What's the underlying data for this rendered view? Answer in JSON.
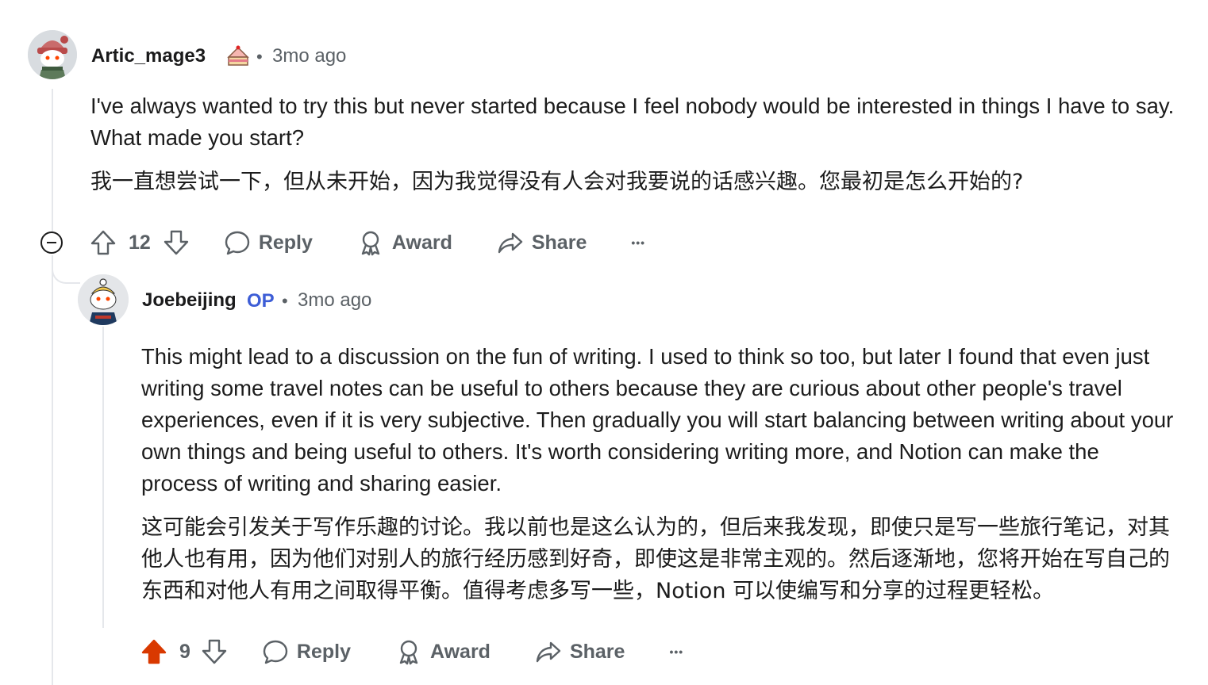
{
  "comment": {
    "username": "Artic_mage3",
    "separator": "•",
    "time": "3mo ago",
    "body_en": "I've always wanted to try this but never started because I feel nobody would be interested in things I have to say. What made you start?",
    "body_zh": "我一直想尝试一下，但从未开始，因为我觉得没有人会对我要说的话感兴趣。您最初是怎么开始的?",
    "votes": "12",
    "reply_label": "Reply",
    "award_label": "Award",
    "share_label": "Share",
    "more_label": "•••"
  },
  "reply": {
    "username": "Joebeijing",
    "op_badge": "OP",
    "separator": "•",
    "time": "3mo ago",
    "body_en": "This might lead to a discussion on the fun of writing. I used to think so too, but later I found that even just writing some travel notes can be useful to others because they are curious about other people's travel experiences, even if it is very subjective. Then gradually you will start balancing between writing about your own things and being useful to others. It's worth considering writing more, and Notion can make the process of writing and sharing easier.",
    "body_zh": "这可能会引发关于写作乐趣的讨论。我以前也是这么认为的，但后来我发现，即使只是写一些旅行笔记，对其他人也有用，因为他们对别人的旅行经历感到好奇，即使这是非常主观的。然后逐渐地，您将开始在写自己的东西和对他人有用之间取得平衡。值得考虑多写一些，Notion 可以使编写和分享的过程更轻松。",
    "votes": "9",
    "upvoted": true,
    "reply_label": "Reply",
    "award_label": "Award",
    "share_label": "Share",
    "more_label": "•••"
  },
  "colors": {
    "upvote_active": "#d93900",
    "op": "#3d5dd6",
    "meta": "#5b6166",
    "thread_line": "#e5e7eb"
  },
  "icons": [
    "upvote-icon",
    "downvote-icon",
    "comment-icon",
    "award-icon",
    "share-icon",
    "collapse-icon",
    "cake-flair-icon"
  ]
}
